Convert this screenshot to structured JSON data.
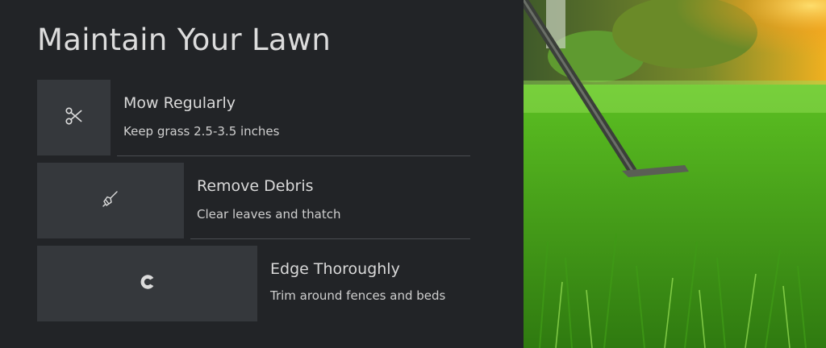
{
  "title": "Maintain Your Lawn",
  "tips": [
    {
      "title": "Mow Regularly",
      "description": "Keep grass 2.5-3.5 inches",
      "icon": "scissors-icon"
    },
    {
      "title": "Remove Debris",
      "description": "Clear leaves and thatch",
      "icon": "broom-icon"
    },
    {
      "title": "Edge Thoroughly",
      "description": "Trim around fences and beds",
      "icon": "edge-trimmer-icon"
    }
  ],
  "colors": {
    "panel_bg": "#222427",
    "tile_bg": "#35383c",
    "text": "#d9d9d9",
    "grass": "#4caf1a"
  }
}
